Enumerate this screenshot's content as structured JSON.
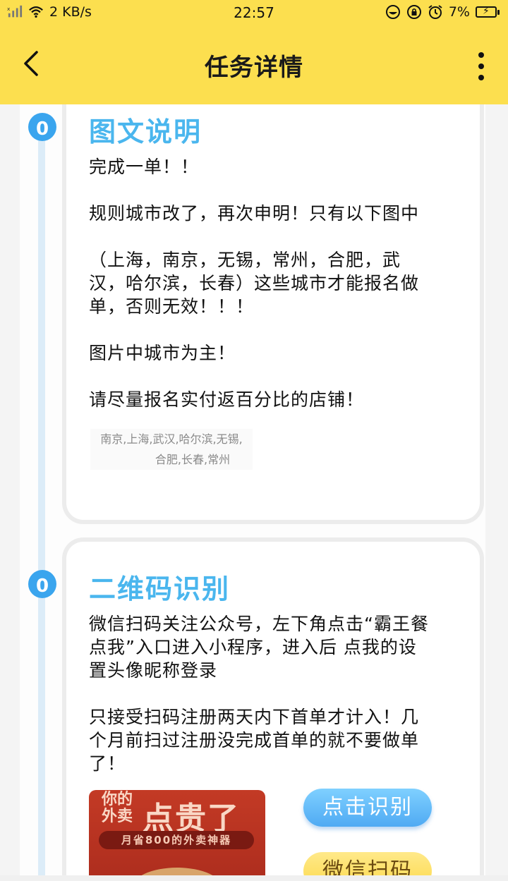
{
  "status_bar": {
    "signal_text": "x",
    "net_speed": "2 KB/s",
    "time": "22:57",
    "battery_percent": "7%",
    "icons": [
      "signal-icon",
      "wifi-icon",
      "eye-icon",
      "lock-rotate-icon",
      "alarm-icon",
      "battery-charging-icon"
    ]
  },
  "header": {
    "title": "任务详情",
    "back_icon": "chevron-left-icon",
    "more_icon": "more-vertical-icon"
  },
  "timeline": {
    "nodes": [
      {
        "label": "0"
      },
      {
        "label": "0"
      }
    ]
  },
  "cards": [
    {
      "title": "图文说明",
      "text": "完成一单！！\n\n规则城市改了，再次申明！只有以下图中\n\n（上海，南京，无锡，常州，合肥，武汉，哈尔滨，长春）这些城市才能报名做单，否则无效！！！\n\n图片中城市为主！\n\n请尽量报名实付返百分比的店铺！",
      "caption_line1": "南京,上海,武汉,哈尔滨,无锡,",
      "caption_line2": "合肥,长春,常州"
    },
    {
      "title": "二维码识别",
      "text": "微信扫码关注公众号，左下角点击“霸王餐点我”入口进入小程序，进入后 点我的设置头像昵称登录\n\n只接受扫码注册两天内下首单才计入！几个月前扫过注册没完成首单的就不要做单了！",
      "promo": {
        "line1": "你的",
        "line2": "外卖",
        "headline": "点贵了",
        "tagline": "月省800的外卖神器"
      },
      "btn_identify": "点击识别",
      "btn_wechat": "微信扫码"
    }
  ]
}
